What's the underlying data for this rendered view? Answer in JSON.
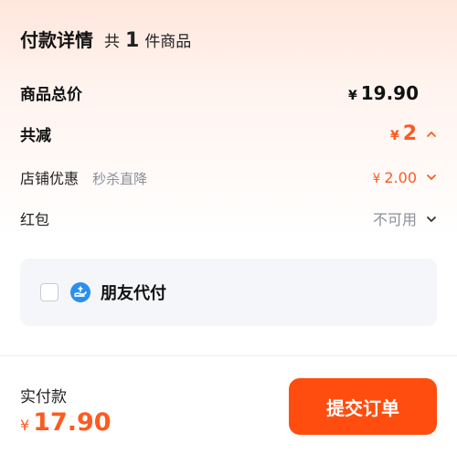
{
  "header": {
    "title": "付款详情",
    "count_prefix": "共",
    "count": "1",
    "count_suffix": "件商品"
  },
  "rows": {
    "total": {
      "label": "商品总价",
      "currency": "¥",
      "amount": "19.90"
    },
    "reduce": {
      "label": "共减",
      "currency": "¥",
      "amount": "2"
    },
    "shop": {
      "label": "店铺优惠",
      "sub": "秒杀直降",
      "currency": "¥",
      "amount": "2.00"
    },
    "redpack": {
      "label": "红包",
      "value": "不可用"
    }
  },
  "friend_pay": {
    "label": "朋友代付",
    "checked": false
  },
  "footer": {
    "label": "实付款",
    "currency": "¥",
    "amount": "17.90",
    "submit_label": "提交订单"
  },
  "colors": {
    "accent": "#ff5a1f",
    "button": "#ff4d0f",
    "muted": "#8a8f99"
  },
  "icons": [
    "chevron-up-icon",
    "chevron-down-icon",
    "friend-pay-icon"
  ]
}
